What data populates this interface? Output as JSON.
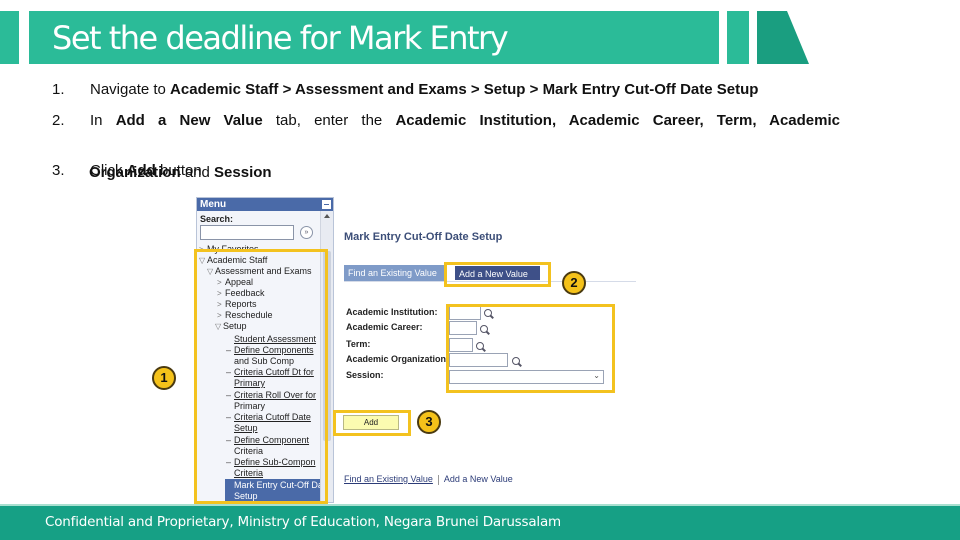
{
  "header": {
    "title": "Set the deadline for Mark Entry",
    "brand_color": "#2bbb98",
    "accent_dark": "#16a085"
  },
  "steps": [
    {
      "number": "1.",
      "parts": [
        "Navigate to ",
        "Academic Staff > Assessment and Exams > Setup > Mark Entry Cut-Off Date Setup"
      ]
    },
    {
      "number": "2.",
      "line1": [
        "In ",
        "Add a New Value",
        " tab, enter the ",
        "Academic Institution, Academic Career, Term, Academic"
      ],
      "line2": [
        "Organization",
        " and ",
        "Session"
      ]
    },
    {
      "number": "3.",
      "parts": [
        "Click ",
        "Add",
        " button"
      ]
    }
  ],
  "menu": {
    "title": "Menu",
    "search_label": "Search:",
    "search_value": "",
    "search_go_icon": "»",
    "items": [
      {
        "label": "My Favorites",
        "level": 0,
        "state": "collapsed"
      },
      {
        "label": "Academic Staff",
        "level": 0,
        "state": "expanded"
      },
      {
        "label": "Assessment and Exams",
        "level": 1,
        "state": "expanded"
      },
      {
        "label": "Appeal",
        "level": 2,
        "state": "collapsed"
      },
      {
        "label": "Feedback",
        "level": 2,
        "state": "collapsed"
      },
      {
        "label": "Reports",
        "level": 2,
        "state": "collapsed"
      },
      {
        "label": "Reschedule",
        "level": 2,
        "state": "collapsed"
      },
      {
        "label": "Setup",
        "level": 2,
        "state": "expanded"
      },
      {
        "label": "Student Assessment",
        "level": 3,
        "link": true
      },
      {
        "label": "Define Components",
        "label2": "and Sub Comp",
        "level": 3,
        "link": true
      },
      {
        "label": "Criteria Cutoff Dt for",
        "label2": "Primary",
        "level": 3,
        "link": true
      },
      {
        "label": "Criteria Roll Over for",
        "label2": "Primary",
        "level": 3,
        "link": true
      },
      {
        "label": "Criteria Cutoff Date",
        "label2": "Setup",
        "level": 3,
        "link": true
      },
      {
        "label": "Define Component",
        "label2": "Criteria",
        "level": 3,
        "link": true
      },
      {
        "label": "Define Sub-Compon",
        "label2": "Criteria",
        "level": 3,
        "link": true
      },
      {
        "label": "Mark Entry Cut-Off Da",
        "label2": "Setup",
        "level": 3,
        "selected": true
      }
    ]
  },
  "content": {
    "page_title": "Mark Entry Cut-Off Date Setup",
    "tabs": [
      {
        "label": "Find an Existing Value",
        "active": false
      },
      {
        "label": "Add a New Value",
        "active": true
      }
    ],
    "fields": [
      {
        "label": "Academic Institution:",
        "value": ""
      },
      {
        "label": "Academic Career:",
        "value": ""
      },
      {
        "label": "Term:",
        "value": ""
      },
      {
        "label": "Academic Organization:",
        "value": ""
      },
      {
        "label": "Session:",
        "value": "",
        "type": "select"
      }
    ],
    "add_button": "Add",
    "bottom_links": [
      "Find an Existing Value",
      "Add a New Value"
    ]
  },
  "annotations": {
    "badges": [
      "1",
      "2",
      "3"
    ],
    "highlight_color": "#f3c21f"
  },
  "footer": {
    "text": "Confidential and Proprietary, Ministry of Education, Negara Brunei Darussalam"
  }
}
